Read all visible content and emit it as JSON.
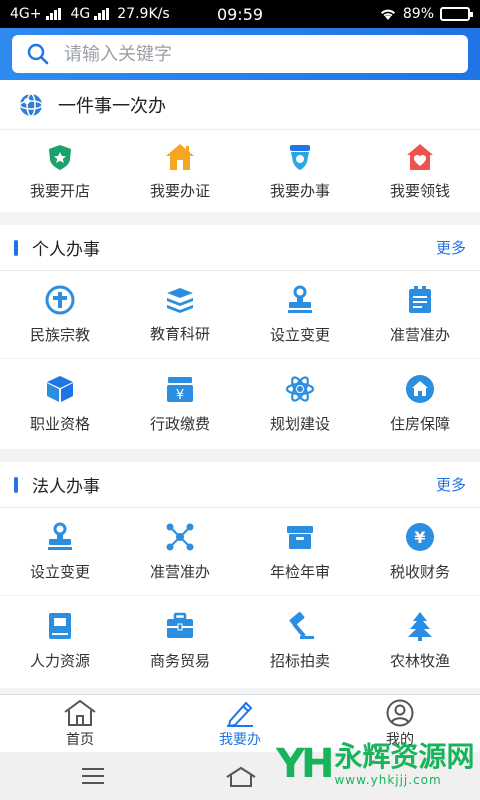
{
  "status_bar": {
    "network1": "4G+",
    "network2": "4G",
    "speed": "27.9K/s",
    "time": "09:59",
    "battery": "89%",
    "battery_level": 0.89
  },
  "search": {
    "placeholder": "请输入关键字",
    "value": ""
  },
  "one_thing": {
    "title": "一件事一次办"
  },
  "quick_actions": [
    {
      "label": "我要开店",
      "icon": "police-badge-icon"
    },
    {
      "label": "我要办证",
      "icon": "house-icon"
    },
    {
      "label": "我要办事",
      "icon": "service-badge-icon"
    },
    {
      "label": "我要领钱",
      "icon": "heart-house-icon"
    }
  ],
  "personal": {
    "title": "个人办事",
    "more": "更多",
    "items": [
      {
        "label": "民族宗教",
        "icon": "cross-circle-icon"
      },
      {
        "label": "教育科研",
        "icon": "books-icon"
      },
      {
        "label": "设立变更",
        "icon": "stamp-icon"
      },
      {
        "label": "准营准办",
        "icon": "clipboard-icon"
      },
      {
        "label": "职业资格",
        "icon": "box-icon"
      },
      {
        "label": "行政缴费",
        "icon": "yuan-box-icon"
      },
      {
        "label": "规划建设",
        "icon": "atom-icon"
      },
      {
        "label": "住房保障",
        "icon": "home-circle-icon"
      }
    ]
  },
  "legal": {
    "title": "法人办事",
    "more": "更多",
    "items": [
      {
        "label": "设立变更",
        "icon": "stamp-icon"
      },
      {
        "label": "准营准办",
        "icon": "network-icon"
      },
      {
        "label": "年检年审",
        "icon": "archive-icon"
      },
      {
        "label": "税收财务",
        "icon": "yuan-circle-icon"
      },
      {
        "label": "人力资源",
        "icon": "book-icon"
      },
      {
        "label": "商务贸易",
        "icon": "briefcase-icon"
      },
      {
        "label": "招标拍卖",
        "icon": "gavel-icon"
      },
      {
        "label": "农林牧渔",
        "icon": "tree-icon"
      }
    ]
  },
  "tabs": [
    {
      "label": "首页",
      "icon": "home-outline-icon",
      "active": false
    },
    {
      "label": "我要办",
      "icon": "pencil-icon",
      "active": true
    },
    {
      "label": "我的",
      "icon": "user-circle-icon",
      "active": false
    }
  ],
  "watermark": {
    "brand": "永辉资源网",
    "url": "www.yhkjjj.com"
  },
  "colors": {
    "primary": "#1f74e6",
    "green": "#1aa36a",
    "orange": "#f5a623",
    "red": "#ef5350"
  }
}
